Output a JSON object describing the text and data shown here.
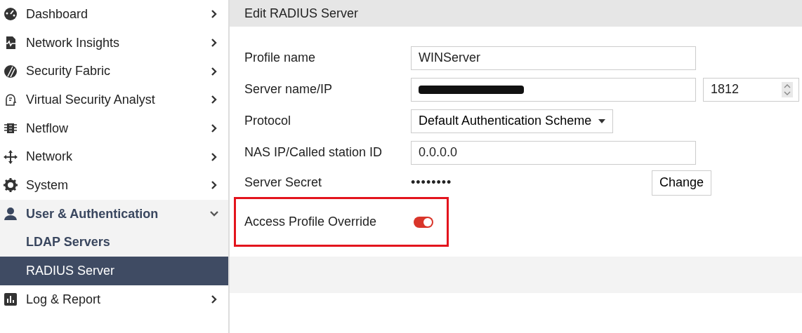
{
  "sidebar": {
    "items": [
      {
        "label": "Dashboard",
        "expanded": false
      },
      {
        "label": "Network Insights",
        "expanded": false
      },
      {
        "label": "Security Fabric",
        "expanded": false
      },
      {
        "label": "Virtual Security Analyst",
        "expanded": false
      },
      {
        "label": "Netflow",
        "expanded": false
      },
      {
        "label": "Network",
        "expanded": false
      },
      {
        "label": "System",
        "expanded": false
      },
      {
        "label": "User & Authentication",
        "expanded": true,
        "children": [
          {
            "label": "LDAP Servers",
            "selected": false
          },
          {
            "label": "RADIUS Server",
            "selected": true
          }
        ]
      },
      {
        "label": "Log & Report",
        "expanded": false
      }
    ]
  },
  "form": {
    "title": "Edit RADIUS Server",
    "fields": [
      {
        "kind": "text",
        "label": "Profile name",
        "value": "WINServer"
      },
      {
        "kind": "host",
        "label": "Server name/IP",
        "redacted": true,
        "port": "1812"
      },
      {
        "kind": "select",
        "label": "Protocol",
        "value": "Default Authentication Scheme"
      },
      {
        "kind": "text",
        "label": "NAS IP/Called station ID",
        "value": "0.0.0.0"
      },
      {
        "kind": "secret",
        "label": "Server Secret",
        "value": "••••••••",
        "button": "Change"
      },
      {
        "kind": "toggle",
        "label": "Access Profile Override",
        "on": true,
        "highlighted": true
      }
    ]
  }
}
